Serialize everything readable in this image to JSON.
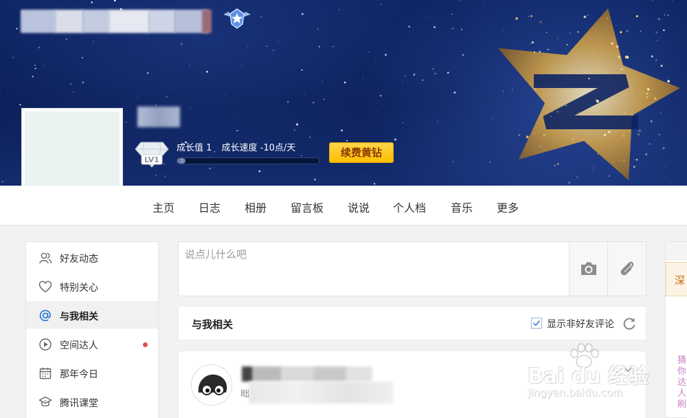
{
  "profile": {
    "growth_value_text": "成长值 1",
    "growth_speed_text": "成长速度 -10点/天",
    "growth_progress": 0.06,
    "growth_bar_number": "1",
    "level_text": "LV1",
    "renew_label": "续费黄钻"
  },
  "nav": {
    "items": [
      {
        "label": "主页"
      },
      {
        "label": "日志"
      },
      {
        "label": "相册"
      },
      {
        "label": "留言板"
      },
      {
        "label": "说说"
      },
      {
        "label": "个人档"
      },
      {
        "label": "音乐"
      },
      {
        "label": "更多"
      }
    ]
  },
  "sidebar": {
    "items": [
      {
        "label": "好友动态",
        "icon": "friends-icon"
      },
      {
        "label": "特别关心",
        "icon": "heart-icon"
      },
      {
        "label": "与我相关",
        "icon": "at-icon",
        "active": true
      },
      {
        "label": "空间达人",
        "icon": "play-circle-icon",
        "has_dot": true
      },
      {
        "label": "那年今日",
        "icon": "calendar-icon"
      },
      {
        "label": "腾讯课堂",
        "icon": "graduation-cap-icon"
      }
    ]
  },
  "post": {
    "placeholder": "说点儿什么吧",
    "camera_icon": "camera-icon",
    "attach_icon": "paperclip-icon"
  },
  "related": {
    "title": "与我相关",
    "show_nonfriend_label": "显示非好友评论",
    "show_nonfriend_checked": true
  },
  "feed": {
    "initial_char": "昢"
  },
  "right_panel": {
    "tab_label": "深",
    "vertical_text": "猜你达人刷"
  },
  "watermark": {
    "main": "Bai du 经验",
    "sub": "jingyan.baidu.com"
  },
  "colors": {
    "banner_bg": "#0b1f58",
    "renew_button": "#ffc400",
    "page_bg": "#f2f2f2",
    "active_item_bg": "#f1f1f1",
    "notify_dot": "#e05050"
  }
}
